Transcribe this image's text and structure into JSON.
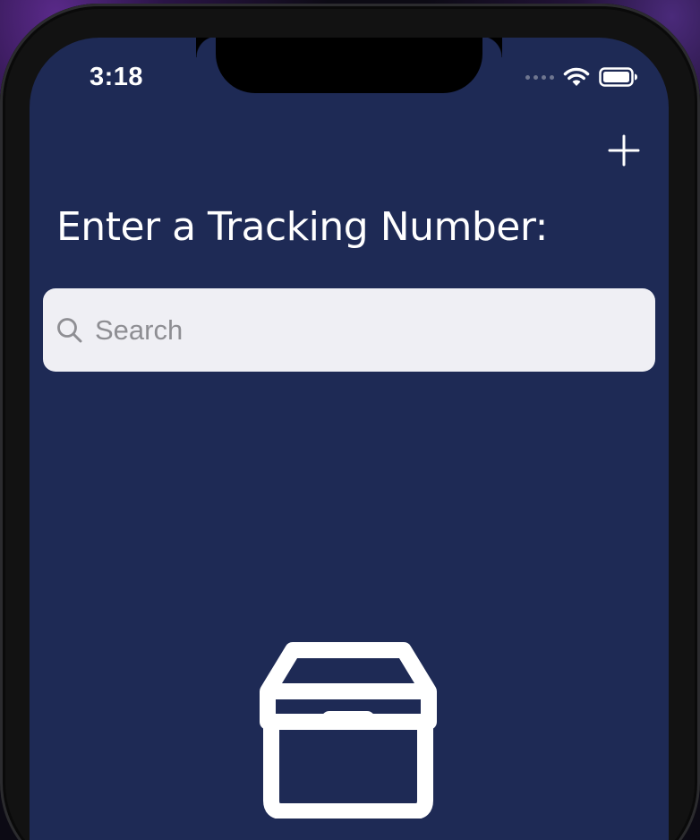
{
  "status_bar": {
    "time": "3:18"
  },
  "header": {
    "title": "Enter a Tracking Number:",
    "add_icon": "plus-icon"
  },
  "search": {
    "placeholder": "Search",
    "value": ""
  },
  "empty_state": {
    "icon": "package-box-icon"
  },
  "colors": {
    "background": "#1e2a55",
    "search_field": "#efeff4",
    "text": "#ffffff",
    "placeholder": "#8e8e93"
  }
}
